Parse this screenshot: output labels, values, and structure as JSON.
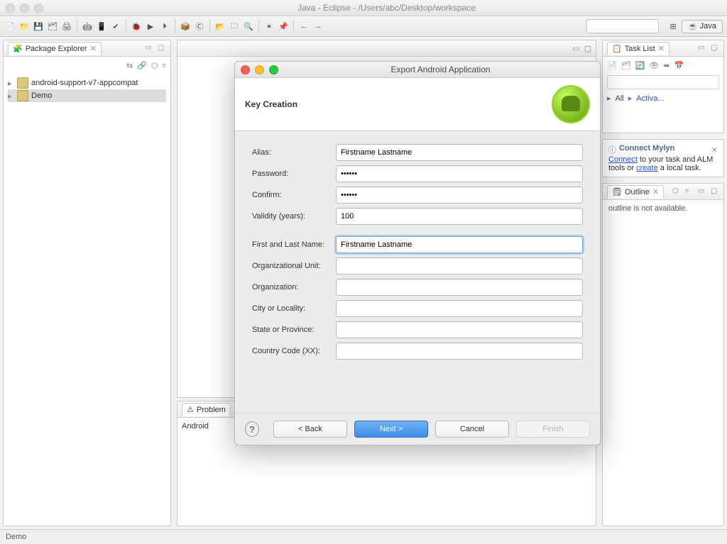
{
  "window": {
    "title": "Java - Eclipse - /Users/abc/Desktop/workspace"
  },
  "perspective": {
    "label": "Java"
  },
  "packageExplorer": {
    "title": "Package Explorer",
    "items": [
      "android-support-v7-appcompat",
      "Demo"
    ]
  },
  "taskList": {
    "title": "Task List",
    "all": "All",
    "activate": "Activa..."
  },
  "mylyn": {
    "title": "Connect Mylyn",
    "text_before_connect": "",
    "connect": "Connect",
    "text_mid": " to your task and ALM tools or ",
    "create": "create",
    "text_after": " a local task."
  },
  "outline": {
    "title": "Outline",
    "message": "outline is not available."
  },
  "problems": {
    "tab": "Problem",
    "selected": "Android"
  },
  "status": {
    "text": "Demo"
  },
  "dialog": {
    "title": "Export Android Application",
    "heading": "Key Creation",
    "labels": {
      "alias": "Alias:",
      "password": "Password:",
      "confirm": "Confirm:",
      "validity": "Validity (years):",
      "first_last": "First and Last Name:",
      "org_unit": "Organizational Unit:",
      "org": "Organization:",
      "city": "City or Locality:",
      "state": "State or Province:",
      "country": "Country Code (XX):"
    },
    "values": {
      "alias": "Firstname Lastname",
      "password": "••••••",
      "confirm": "••••••",
      "validity": "100",
      "first_last": "Firstname Lastname",
      "org_unit": "",
      "org": "",
      "city": "",
      "state": "",
      "country": ""
    },
    "buttons": {
      "back": "< Back",
      "next": "Next >",
      "cancel": "Cancel",
      "finish": "Finish"
    }
  }
}
